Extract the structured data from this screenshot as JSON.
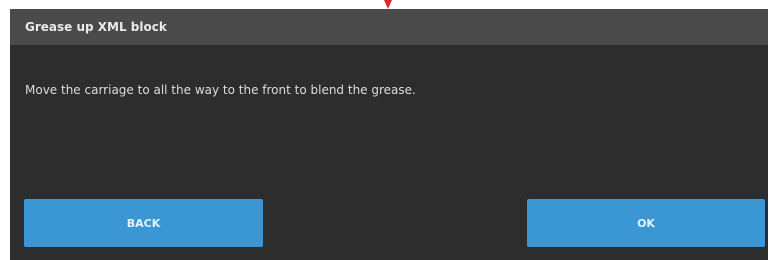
{
  "dialog": {
    "title": "Grease up XML block",
    "message": "Move the carriage to all the way to the front to blend the grease.",
    "back_label": "BACK",
    "ok_label": "OK"
  },
  "colors": {
    "header": "#4a4a4a",
    "body": "#2d2d2d",
    "button": "#3a97d4",
    "pointer": "#d92b2b"
  }
}
